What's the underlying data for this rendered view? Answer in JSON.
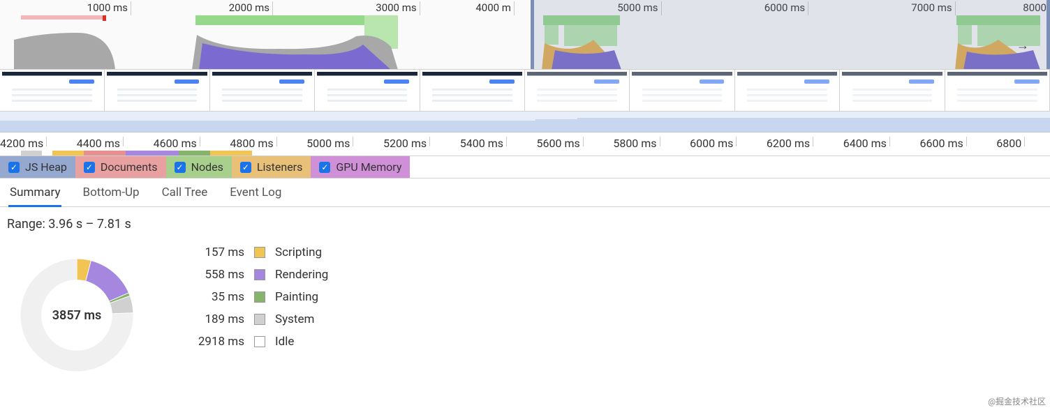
{
  "overview": {
    "ticks": [
      "1000 ms",
      "2000 ms",
      "3000 ms",
      "4000 m",
      "5000 ms",
      "6000 ms",
      "7000 ms",
      "8000"
    ],
    "tick_positions_pct": [
      12.5,
      26,
      40,
      49,
      63,
      77,
      91,
      100
    ],
    "selection_left_pct": 50.5,
    "selection_right_pct": 100,
    "red_bar_left_pct": 2,
    "red_bar_width_pct": 8
  },
  "filmstrip": {
    "frames": 10
  },
  "detail_timeline": {
    "ticks": [
      "4200 ms",
      "4400 ms",
      "4600 ms",
      "4800 ms",
      "5000 ms",
      "5200 ms",
      "5400 ms",
      "5600 ms",
      "5800 ms",
      "6000 ms",
      "6200 ms",
      "6400 ms",
      "6600 ms",
      "6800"
    ]
  },
  "memory_checks": [
    {
      "key": "js",
      "label": "JS Heap"
    },
    {
      "key": "doc",
      "label": "Documents"
    },
    {
      "key": "node",
      "label": "Nodes"
    },
    {
      "key": "lis",
      "label": "Listeners"
    },
    {
      "key": "gpu",
      "label": "GPU Memory"
    }
  ],
  "tabs": [
    "Summary",
    "Bottom-Up",
    "Call Tree",
    "Event Log"
  ],
  "active_tab": "Summary",
  "range_text": "Range: 3.96 s – 7.81 s",
  "donut_total": "3857 ms",
  "legend": [
    {
      "value": "157 ms",
      "name": "Scripting",
      "color": "#f1c453"
    },
    {
      "value": "558 ms",
      "name": "Rendering",
      "color": "#a587e0"
    },
    {
      "value": "35 ms",
      "name": "Painting",
      "color": "#86b46a"
    },
    {
      "value": "189 ms",
      "name": "System",
      "color": "#d0d0d0"
    },
    {
      "value": "2918 ms",
      "name": "Idle",
      "color": "#ffffff"
    }
  ],
  "chart_data": {
    "type": "pie",
    "title": "3857 ms",
    "series": [
      {
        "name": "Scripting",
        "value": 157,
        "color": "#f1c453"
      },
      {
        "name": "Rendering",
        "value": 558,
        "color": "#a587e0"
      },
      {
        "name": "Painting",
        "value": 35,
        "color": "#86b46a"
      },
      {
        "name": "System",
        "value": 189,
        "color": "#d0d0d0"
      },
      {
        "name": "Idle",
        "value": 2918,
        "color": "#f0f0f0"
      }
    ]
  },
  "watermark": "@掘金技术社区"
}
